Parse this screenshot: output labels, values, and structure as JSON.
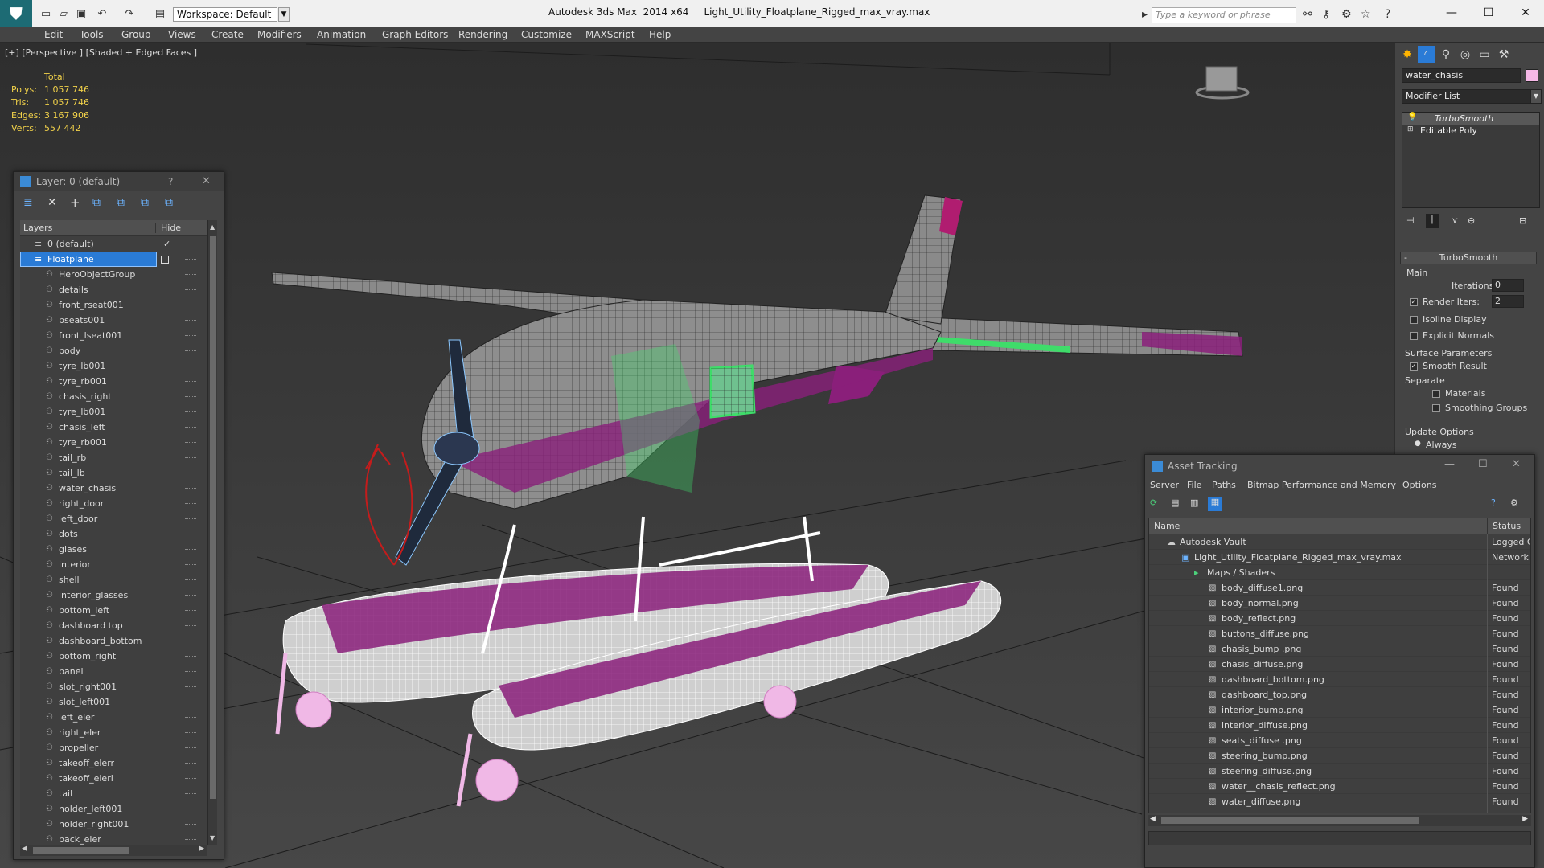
{
  "window": {
    "app_title": "Autodesk 3ds Max  2014 x64",
    "file_name": "Light_Utility_Floatplane_Rigged_max_vray.max",
    "workspace_label": "Workspace: Default",
    "search_placeholder": "Type a keyword or phrase"
  },
  "menu": [
    "Edit",
    "Tools",
    "Group",
    "Views",
    "Create",
    "Modifiers",
    "Animation",
    "Graph Editors",
    "Rendering",
    "Customize",
    "MAXScript",
    "Help"
  ],
  "viewport": {
    "label": "[+] [Perspective ] [Shaded + Edged Faces ]",
    "stats": {
      "header": "Total",
      "rows": [
        {
          "label": "Polys:",
          "value": "1 057 746"
        },
        {
          "label": "Tris:",
          "value": "1 057 746"
        },
        {
          "label": "Edges:",
          "value": "3 167 906"
        },
        {
          "label": "Verts:",
          "value": "557 442"
        }
      ]
    }
  },
  "layer_panel": {
    "title": "Layer: 0 (default)",
    "help": "?",
    "close": "✕",
    "col_layers": "Layers",
    "col_hide": "Hide",
    "default_layer": "0 (default)",
    "selected_layer": "Floatplane",
    "objects": [
      "HeroObjectGroup",
      "details",
      "front_rseat001",
      "bseats001",
      "front_lseat001",
      "body",
      "tyre_lb001",
      "tyre_rb001",
      "chasis_right",
      "tyre_lb001",
      "chasis_left",
      "tyre_rb001",
      "tail_rb",
      "tail_lb",
      "water_chasis",
      "right_door",
      "left_door",
      "dots",
      "glases",
      "interior",
      "shell",
      "interior_glasses",
      "bottom_left",
      "dashboard top",
      "dashboard_bottom",
      "bottom_right",
      "panel",
      "slot_right001",
      "slot_left001",
      "left_eler",
      "right_eler",
      "propeller",
      "takeoff_elerr",
      "takeoff_elerl",
      "tail",
      "holder_left001",
      "holder_right001",
      "back_eler"
    ]
  },
  "command_panel": {
    "object_name": "water_chasis",
    "modifier_list": "Modifier List",
    "stack": [
      "TurboSmooth",
      "Editable Poly"
    ],
    "turbosmooth": {
      "title": "TurboSmooth",
      "group_main": "Main",
      "iterations_label": "Iterations:",
      "iterations_value": "0",
      "render_iters_label": "Render Iters:",
      "render_iters_value": "2",
      "isoline_label": "Isoline Display",
      "explicit_normals_label": "Explicit Normals",
      "surface_params_label": "Surface Parameters",
      "smooth_result_label": "Smooth Result",
      "separate_label": "Separate",
      "materials_label": "Materials",
      "smoothing_groups_label": "Smoothing Groups",
      "update_options_label": "Update Options",
      "always_label": "Always"
    }
  },
  "asset_tracking": {
    "title": "Asset Tracking",
    "menu": [
      "Server",
      "File",
      "Paths",
      "Bitmap Performance and Memory",
      "Options"
    ],
    "col_name": "Name",
    "col_status": "Status",
    "vault": {
      "name": "Autodesk Vault",
      "status": "Logged C"
    },
    "file": {
      "name": "Light_Utility_Floatplane_Rigged_max_vray.max",
      "status": "Network I"
    },
    "group": "Maps / Shaders",
    "maps": [
      {
        "name": "body_diffuse1.png",
        "status": "Found"
      },
      {
        "name": "body_normal.png",
        "status": "Found"
      },
      {
        "name": "body_reflect.png",
        "status": "Found"
      },
      {
        "name": "buttons_diffuse.png",
        "status": "Found"
      },
      {
        "name": "chasis_bump .png",
        "status": "Found"
      },
      {
        "name": "chasis_diffuse.png",
        "status": "Found"
      },
      {
        "name": "dashboard_bottom.png",
        "status": "Found"
      },
      {
        "name": "dashboard_top.png",
        "status": "Found"
      },
      {
        "name": "interior_bump.png",
        "status": "Found"
      },
      {
        "name": "interior_diffuse.png",
        "status": "Found"
      },
      {
        "name": "seats_diffuse .png",
        "status": "Found"
      },
      {
        "name": "steering_bump.png",
        "status": "Found"
      },
      {
        "name": "steering_diffuse.png",
        "status": "Found"
      },
      {
        "name": "water__chasis_reflect.png",
        "status": "Found"
      },
      {
        "name": "water_diffuse.png",
        "status": "Found"
      }
    ]
  },
  "colors": {
    "accent_magenta": "#8a1f7a",
    "selection_green": "#3fdc6a",
    "stats_yellow": "#f2d24a",
    "selection_blue": "#2a7bd6"
  }
}
